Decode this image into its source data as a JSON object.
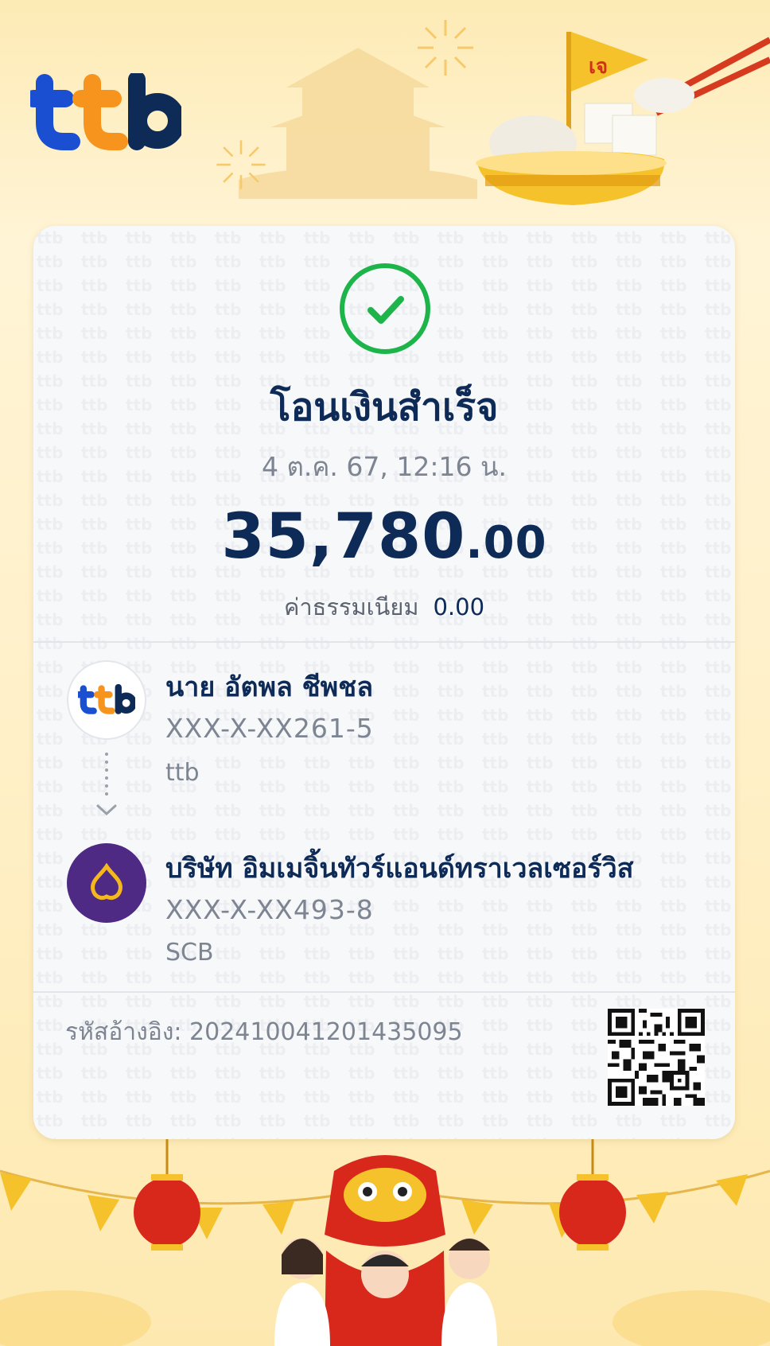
{
  "brand": {
    "logo_text": "ttb",
    "blue": "#1a4fd1",
    "orange": "#f7941d",
    "navy": "#0e2a56"
  },
  "decor": {
    "flag_text": "เจ"
  },
  "receipt": {
    "status_icon": "check-circle-icon",
    "status_color": "#1db44a",
    "title": "โอนเงินสำเร็จ",
    "datetime": "4 ต.ค. 67, 12:16 น.",
    "amount_main": "35,780",
    "amount_decimal": ".00",
    "fee_label": "ค่าธรรมเนียม",
    "fee_value": "0.00"
  },
  "sender": {
    "avatar_icon": "ttb-logo-icon",
    "name": "นาย อัตพล ชีพชล",
    "account": "XXX-X-XX261-5",
    "bank": "ttb"
  },
  "receiver": {
    "avatar_icon": "scb-logo-icon",
    "name": "บริษัท อิมเมจิ้นทัวร์แอนด์ทราเวลเซอร์วิส",
    "account": "XXX-X-XX493-8",
    "bank": "SCB"
  },
  "footer": {
    "reference": "รหัสอ้างอิง: 2024100412014350​95",
    "qr_icon": "qr-code-icon"
  }
}
